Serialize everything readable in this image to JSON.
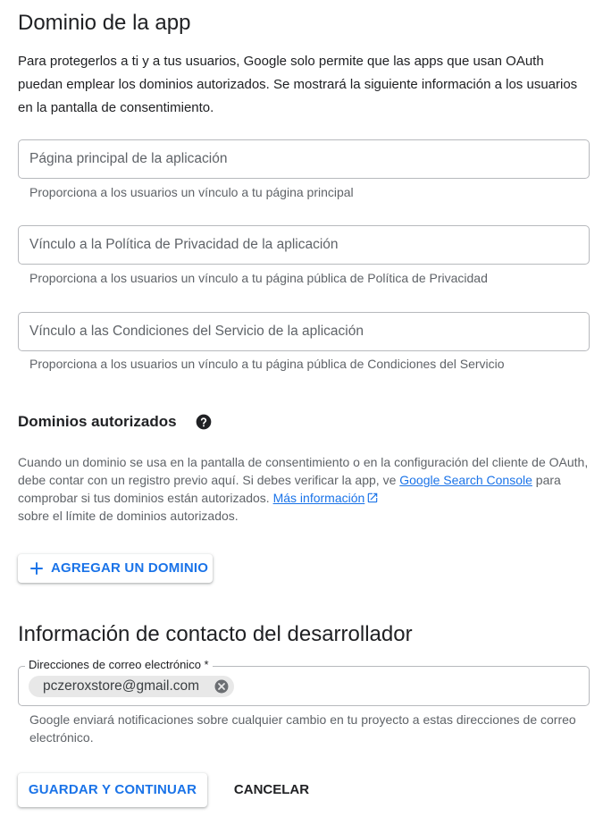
{
  "app_domain": {
    "title": "Dominio de la app",
    "intro": "Para protegerlos a ti y a tus usuarios, Google solo permite que las apps que usan OAuth puedan emplear los dominios autorizados. Se mostrará la siguiente información a los usuarios en la pantalla de consentimiento.",
    "fields": [
      {
        "placeholder": "Página principal de la aplicación",
        "value": "",
        "hint": "Proporciona a los usuarios un vínculo a tu página principal"
      },
      {
        "placeholder": "Vínculo a la Política de Privacidad de la aplicación",
        "value": "",
        "hint": "Proporciona a los usuarios un vínculo a tu página pública de Política de Privacidad"
      },
      {
        "placeholder": "Vínculo a las Condiciones del Servicio de la aplicación",
        "value": "",
        "hint": "Proporciona a los usuarios un vínculo a tu página pública de Condiciones del Servicio"
      }
    ]
  },
  "authorized_domains": {
    "title": "Dominios autorizados",
    "help_icon": "help-circle-icon",
    "desc_before": "Cuando un dominio se usa en la pantalla de consentimiento o en la configuración del cliente de OAuth, debe contar con un registro previo aquí. Si debes verificar la app, ve ",
    "search_console_link": "Google Search Console",
    "desc_middle": " para comprobar si tus dominios están autorizados. ",
    "more_info_link": "Más información",
    "more_info_icon": "open-in-new-icon",
    "desc_after": " sobre el límite de dominios autorizados.",
    "add_button": "AGREGAR UN DOMINIO",
    "add_icon": "plus-icon"
  },
  "developer_contact": {
    "title": "Información de contacto del desarrollador",
    "field_label": "Direcciones de correo electrónico *",
    "emails": [
      "pczeroxstore@gmail.com"
    ],
    "chip_close_icon": "cancel-circle-icon",
    "hint": "Google enviará notificaciones sobre cualquier cambio en tu proyecto a estas direcciones de correo electrónico."
  },
  "actions": {
    "save": "GUARDAR Y CONTINUAR",
    "cancel": "CANCELAR"
  },
  "colors": {
    "link": "#1a73e8",
    "text": "#202124",
    "secondary_text": "#5f6368",
    "border": "#b7b9bd",
    "chip": "#e8e8e8"
  }
}
